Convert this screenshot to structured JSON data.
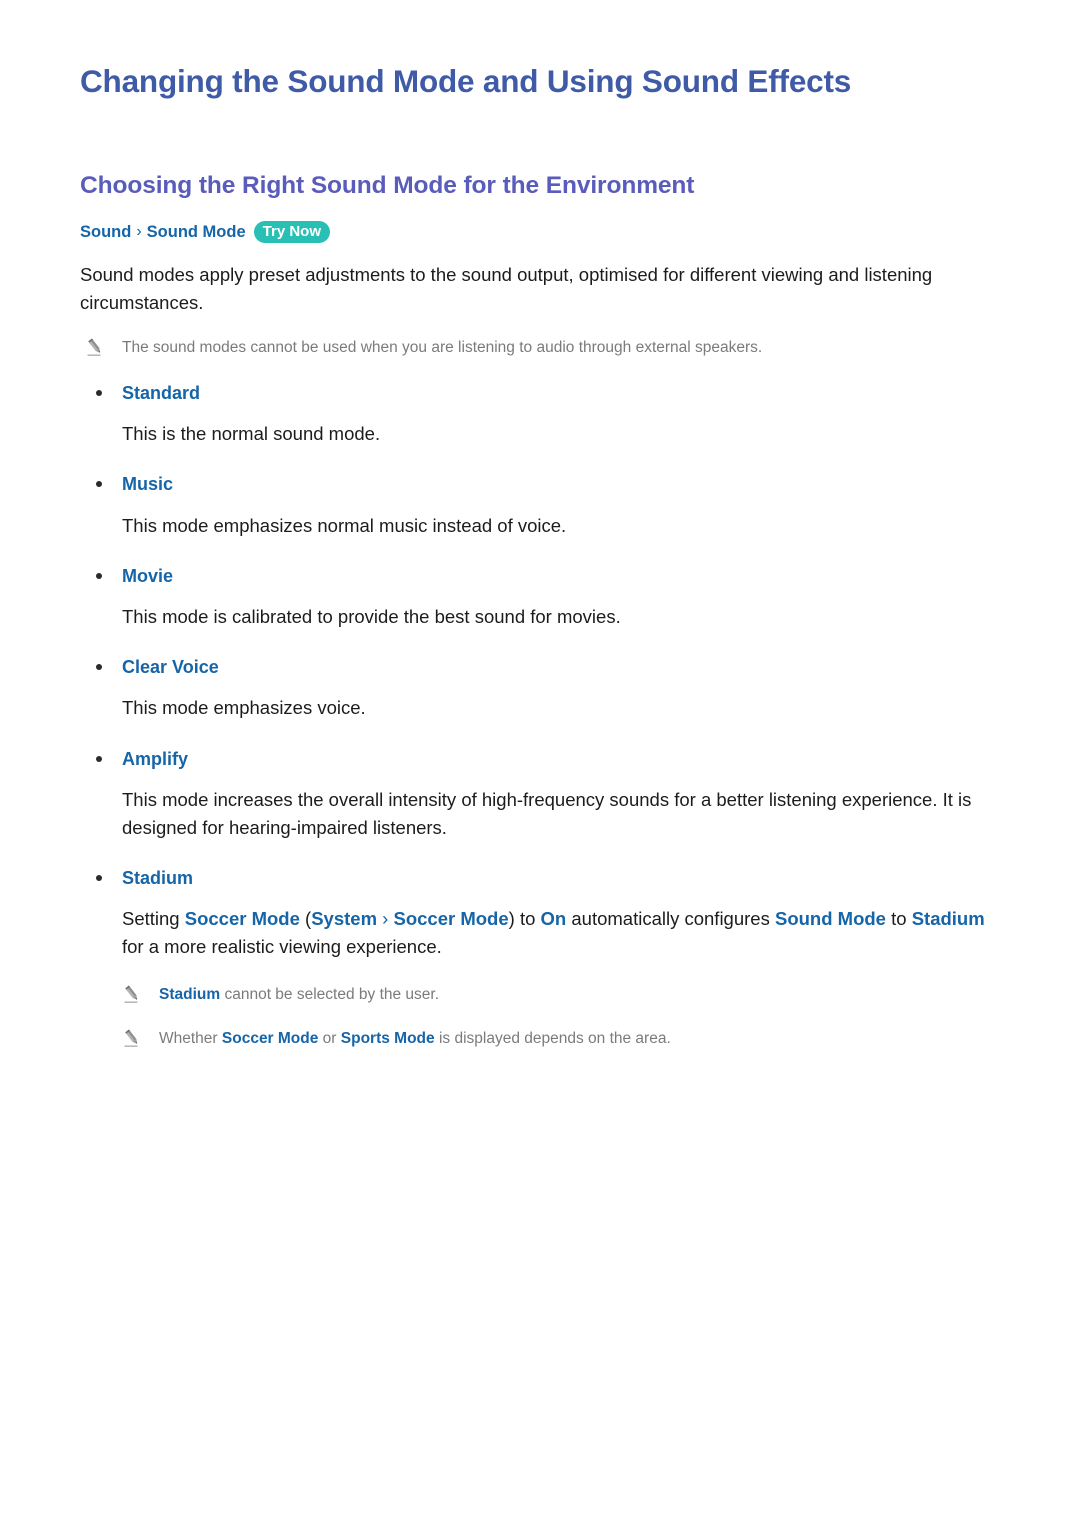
{
  "document": {
    "title": "Changing the Sound Mode and Using Sound Effects",
    "section_title": "Choosing the Right Sound Mode for the Environment"
  },
  "breadcrumb": {
    "items": [
      "Sound",
      "Sound Mode"
    ],
    "separator": "›",
    "badge": "Try Now"
  },
  "intro": {
    "paragraph": "Sound modes apply preset adjustments to the sound output, optimised for different viewing and listening circumstances.",
    "note": "The sound modes cannot be used when you are listening to audio through external speakers."
  },
  "sound_modes": [
    {
      "label": "Standard",
      "description": "This is the normal sound mode."
    },
    {
      "label": "Music",
      "description": "This mode emphasizes normal music instead of voice."
    },
    {
      "label": "Movie",
      "description": "This mode is calibrated to provide the best sound for movies."
    },
    {
      "label": "Clear Voice",
      "description": "This mode emphasizes voice."
    },
    {
      "label": "Amplify",
      "description": "This mode increases the overall intensity of high-frequency sounds for a better listening experience. It is designed for hearing-impaired listeners."
    },
    {
      "label": "Stadium",
      "description_parts": {
        "t1": "Setting ",
        "b1": "Soccer Mode",
        "t2": " (",
        "b2": "System",
        "arrow": " › ",
        "b3": "Soccer Mode",
        "t3": ") to ",
        "b4": "On",
        "t4": " automatically configures ",
        "b5": "Sound Mode",
        "t5": " to ",
        "b6": "Stadium",
        "t6": " for a more realistic viewing experience."
      }
    }
  ],
  "stadium_notes": [
    {
      "term": "Stadium",
      "text": " cannot be selected by the user."
    },
    {
      "pre": "Whether ",
      "term1": "Soccer Mode",
      "mid": " or ",
      "term2": "Sports Mode",
      "post": " is displayed depends on the area."
    }
  ],
  "colors": {
    "title_blue": "#3f5aa6",
    "section_purple": "#5a5cbb",
    "link_blue": "#1565a8",
    "badge_teal": "#28c0b5",
    "note_gray": "#7b7b7b",
    "body_black": "#1c1c1c"
  },
  "icons": {
    "pencil": "pencil-icon",
    "bullet": "bullet-dot-icon"
  }
}
